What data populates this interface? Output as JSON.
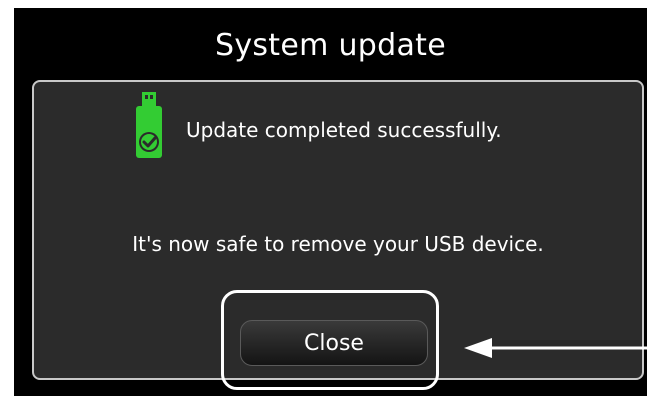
{
  "dialog": {
    "title": "System update",
    "success_message": "Update completed successfully.",
    "remove_message": "It's now safe to remove your USB device.",
    "close_label": "Close",
    "icon": "usb-check-icon"
  },
  "colors": {
    "background": "#000000",
    "panel": "#2b2b2b",
    "icon_green": "#33cc33",
    "text": "#ffffff",
    "annotation": "#ffffff"
  },
  "annotation": {
    "highlight": "close-button-highlight",
    "pointer": "arrow-pointer-icon"
  }
}
